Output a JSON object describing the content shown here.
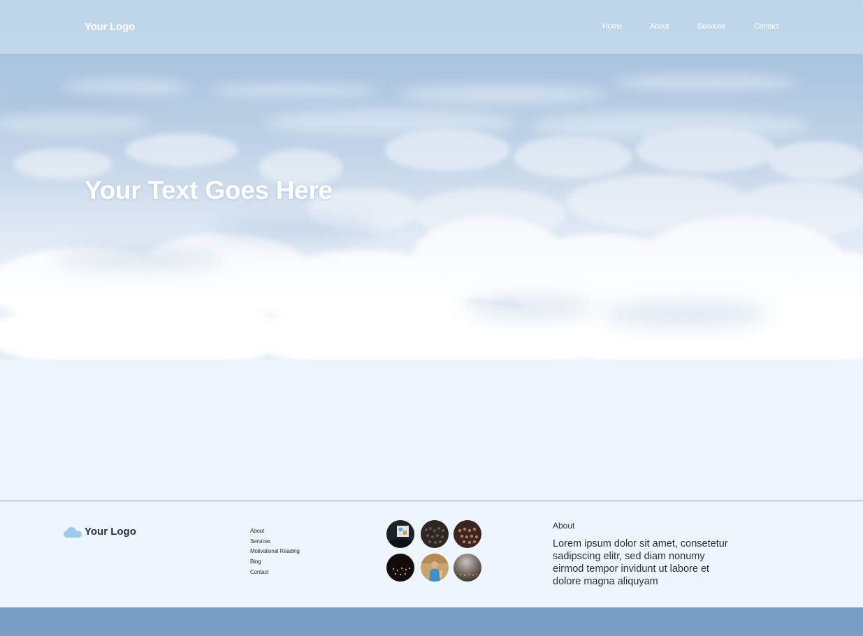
{
  "header": {
    "logo": "Your Logo",
    "nav": [
      "Home",
      "About",
      "Services",
      "Contact"
    ]
  },
  "hero": {
    "title": "Your Text Goes Here"
  },
  "footer": {
    "logo": "Your Logo",
    "links": [
      "About",
      "Services",
      "Motivational Reading",
      "Blog",
      "Contact"
    ],
    "about_title": "About",
    "about_text": "Lorem ipsum dolor sit amet, consetetur sadipscing elitr, sed diam nonumy eirmod tempor invidunt ut labore et dolore magna aliquyam"
  },
  "colors": {
    "background": "#edf6fe",
    "footer_bar": "#7a9fc6",
    "text_dark": "#2a2f36",
    "logo_cloud": "#9ec9ef"
  }
}
